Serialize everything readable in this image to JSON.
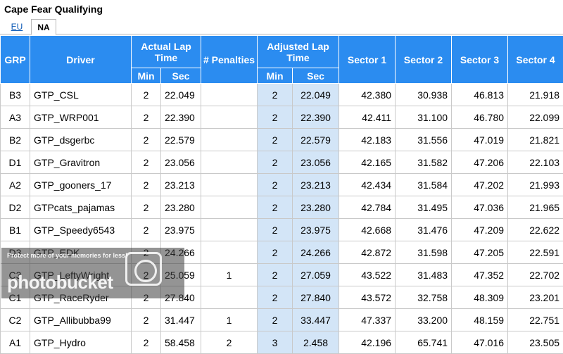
{
  "page": {
    "title": "Cape Fear Qualifying"
  },
  "tabs": [
    {
      "label": "EU",
      "active": false
    },
    {
      "label": "NA",
      "active": true
    }
  ],
  "table": {
    "headers": {
      "grp": "GRP",
      "driver": "Driver",
      "actual_lap_time": "Actual Lap Time",
      "penalties": "# Penalties",
      "adjusted_lap_time": "Adjusted Lap Time",
      "min": "Min",
      "sec": "Sec",
      "sector1": "Sector 1",
      "sector2": "Sector 2",
      "sector3": "Sector 3",
      "sector4": "Sector 4"
    },
    "rows": [
      {
        "grp": "B3",
        "driver": "GTP_CSL",
        "act_min": "2",
        "act_sec": "22.049",
        "penalties": "",
        "adj_min": "2",
        "adj_sec": "22.049",
        "s1": "42.380",
        "s2": "30.938",
        "s3": "46.813",
        "s4": "21.918"
      },
      {
        "grp": "A3",
        "driver": "GTP_WRP001",
        "act_min": "2",
        "act_sec": "22.390",
        "penalties": "",
        "adj_min": "2",
        "adj_sec": "22.390",
        "s1": "42.411",
        "s2": "31.100",
        "s3": "46.780",
        "s4": "22.099"
      },
      {
        "grp": "B2",
        "driver": "GTP_dsgerbc",
        "act_min": "2",
        "act_sec": "22.579",
        "penalties": "",
        "adj_min": "2",
        "adj_sec": "22.579",
        "s1": "42.183",
        "s2": "31.556",
        "s3": "47.019",
        "s4": "21.821"
      },
      {
        "grp": "D1",
        "driver": "GTP_Gravitron",
        "act_min": "2",
        "act_sec": "23.056",
        "penalties": "",
        "adj_min": "2",
        "adj_sec": "23.056",
        "s1": "42.165",
        "s2": "31.582",
        "s3": "47.206",
        "s4": "22.103"
      },
      {
        "grp": "A2",
        "driver": "GTP_gooners_17",
        "act_min": "2",
        "act_sec": "23.213",
        "penalties": "",
        "adj_min": "2",
        "adj_sec": "23.213",
        "s1": "42.434",
        "s2": "31.584",
        "s3": "47.202",
        "s4": "21.993"
      },
      {
        "grp": "D2",
        "driver": "GTPcats_pajamas",
        "act_min": "2",
        "act_sec": "23.280",
        "penalties": "",
        "adj_min": "2",
        "adj_sec": "23.280",
        "s1": "42.784",
        "s2": "31.495",
        "s3": "47.036",
        "s4": "21.965"
      },
      {
        "grp": "B1",
        "driver": "GTP_Speedy6543",
        "act_min": "2",
        "act_sec": "23.975",
        "penalties": "",
        "adj_min": "2",
        "adj_sec": "23.975",
        "s1": "42.668",
        "s2": "31.476",
        "s3": "47.209",
        "s4": "22.622"
      },
      {
        "grp": "D3",
        "driver": "GTP_EDK",
        "act_min": "2",
        "act_sec": "24.266",
        "penalties": "",
        "adj_min": "2",
        "adj_sec": "24.266",
        "s1": "42.872",
        "s2": "31.598",
        "s3": "47.205",
        "s4": "22.591"
      },
      {
        "grp": "C3",
        "driver": "GTP_LeftyWright",
        "act_min": "2",
        "act_sec": "25.059",
        "penalties": "1",
        "adj_min": "2",
        "adj_sec": "27.059",
        "s1": "43.522",
        "s2": "31.483",
        "s3": "47.352",
        "s4": "22.702"
      },
      {
        "grp": "C1",
        "driver": "GTP_RaceRyder",
        "act_min": "2",
        "act_sec": "27.840",
        "penalties": "",
        "adj_min": "2",
        "adj_sec": "27.840",
        "s1": "43.572",
        "s2": "32.758",
        "s3": "48.309",
        "s4": "23.201"
      },
      {
        "grp": "C2",
        "driver": "GTP_Allibubba99",
        "act_min": "2",
        "act_sec": "31.447",
        "penalties": "1",
        "adj_min": "2",
        "adj_sec": "33.447",
        "s1": "47.337",
        "s2": "33.200",
        "s3": "48.159",
        "s4": "22.751"
      },
      {
        "grp": "A1",
        "driver": "GTP_Hydro",
        "act_min": "2",
        "act_sec": "58.458",
        "penalties": "2",
        "adj_min": "3",
        "adj_sec": "2.458",
        "s1": "42.196",
        "s2": "65.741",
        "s3": "47.016",
        "s4": "23.505"
      }
    ]
  },
  "watermark": {
    "line1": "Protect more of your memories for less!",
    "line2": "photobucket"
  },
  "colors": {
    "header_bg": "#2b8cf0",
    "adjusted_bg": "#d3e5f7",
    "link": "#0a58b5"
  }
}
